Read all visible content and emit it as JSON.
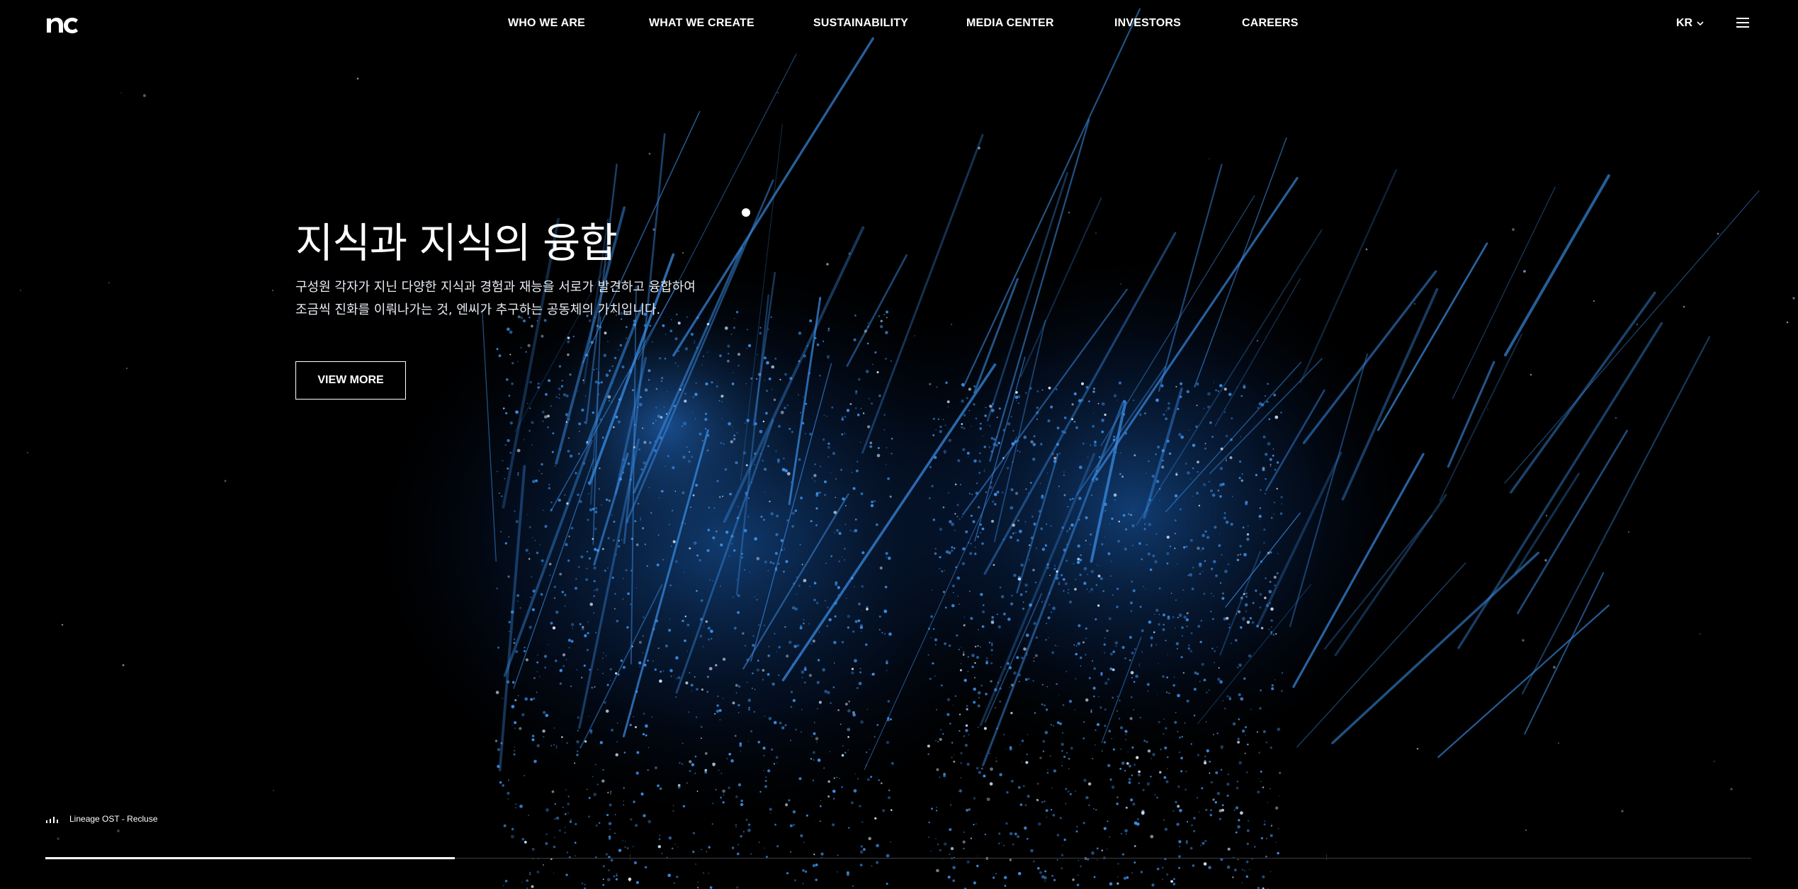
{
  "header": {
    "logo_text": "nc",
    "nav": [
      {
        "label": "WHO WE ARE"
      },
      {
        "label": "WHAT WE CREATE"
      },
      {
        "label": "SUSTAINABILITY"
      },
      {
        "label": "MEDIA CENTER"
      },
      {
        "label": "INVESTORS"
      },
      {
        "label": "CAREERS"
      }
    ],
    "language": "KR"
  },
  "hero": {
    "title": "지식과 지식의 융합",
    "description": [
      "구성원 각자가 지닌 다양한 지식과 경험과 재능을 서로가 발견하고 융합하여",
      "조금씩 진화를 이뤄나가는 것, 엔씨가 추구하는 공동체의 가치입니다."
    ],
    "cta_label": "VIEW MORE"
  },
  "player": {
    "track_label": "Lineage OST - Recluse"
  },
  "slider": {
    "progress_fraction": 0.24
  },
  "colors": {
    "background": "#000000",
    "text": "#ffffff",
    "accent_blue": "#3a8ee6"
  }
}
